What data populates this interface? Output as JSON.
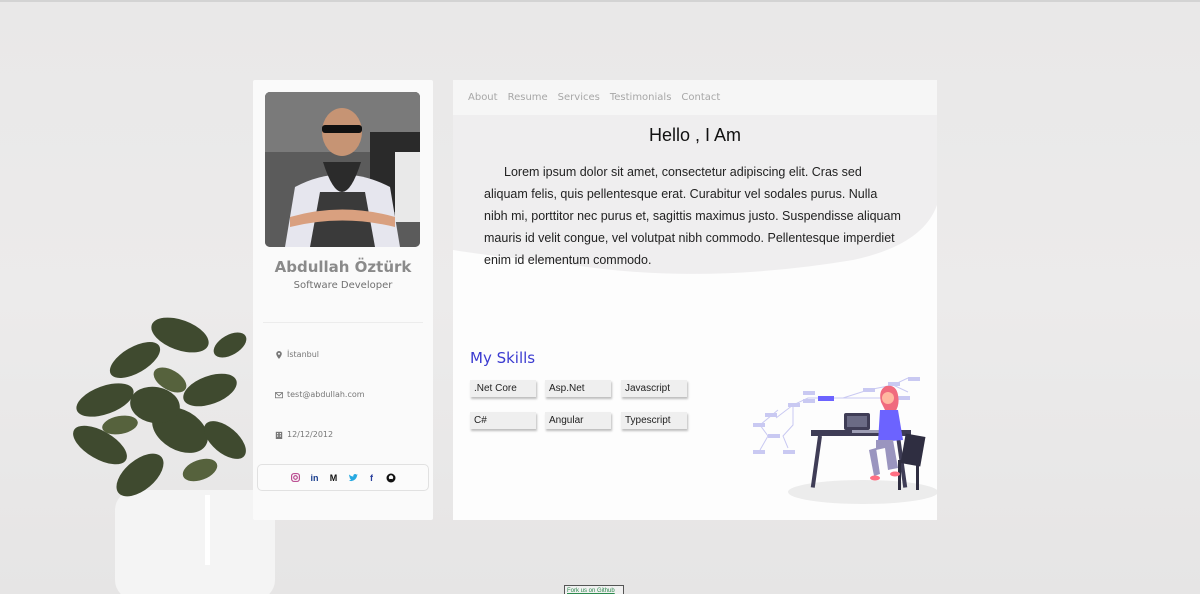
{
  "profile": {
    "name": "Abdullah Öztürk",
    "role": "Software Developer",
    "location": "İstanbul",
    "email": "test@abdullah.com",
    "date": "12/12/2012",
    "social_icons": [
      "instagram-icon",
      "linkedin-icon",
      "medium-icon",
      "twitter-icon",
      "facebook-icon",
      "github-icon"
    ]
  },
  "nav": {
    "items": [
      "About",
      "Resume",
      "Services",
      "Testimonials",
      "Contact"
    ]
  },
  "about": {
    "heading": "Hello , I Am",
    "text": "Lorem ipsum dolor sit amet, consectetur adipiscing elit. Cras sed aliquam felis, quis pellentesque erat. Curabitur vel sodales purus. Nulla nibh mi, porttitor nec purus et, sagittis maximus justo. Suspendisse aliquam mauris id velit congue, vel volutpat nibh commodo. Pellentesque imperdiet enim id elementum commodo."
  },
  "skills": {
    "title": "My Skills",
    "items": [
      ".Net Core",
      "Asp.Net",
      "Javascript",
      "C#",
      "Angular",
      "Typescript"
    ]
  },
  "footer": {
    "link": "Fork us on Github"
  },
  "colors": {
    "accent": "#3b3bd0",
    "illustration": "#6c63ff",
    "figure_hair": "#f06b7e"
  }
}
